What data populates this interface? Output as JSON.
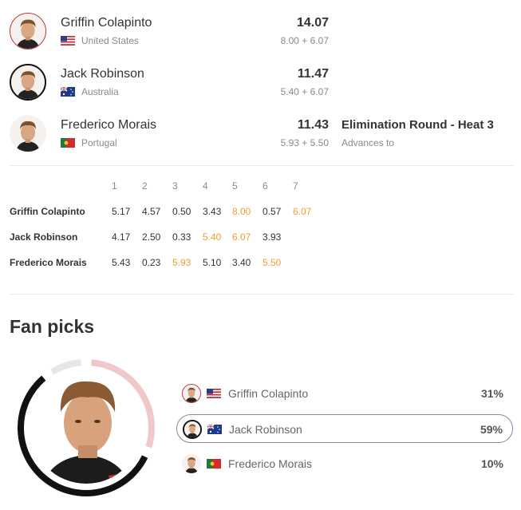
{
  "heat": {
    "surfers": [
      {
        "name": "Griffin Colapinto",
        "country": "United States",
        "flag": "us-flag",
        "total": "14.07",
        "breakdown": "8.00 + 6.07",
        "avatar_ring": "#c0303a"
      },
      {
        "name": "Jack Robinson",
        "country": "Australia",
        "flag": "au-flag",
        "total": "11.47",
        "breakdown": "5.40 + 6.07",
        "avatar_ring": "#111111"
      },
      {
        "name": "Frederico Morais",
        "country": "Portugal",
        "flag": "pt-flag",
        "total": "11.43",
        "breakdown": "5.93 + 5.50",
        "avatar_ring": "#ffffff"
      }
    ],
    "next_round": {
      "title": "Elimination Round - Heat 3",
      "subtitle": "Advances to"
    }
  },
  "waves": {
    "headers": [
      "1",
      "2",
      "3",
      "4",
      "5",
      "6",
      "7"
    ],
    "rows": [
      {
        "name": "Griffin Colapinto",
        "scores": [
          "5.17",
          "4.57",
          "0.50",
          "3.43",
          "8.00",
          "0.57",
          "6.07"
        ],
        "counting": [
          4,
          6
        ]
      },
      {
        "name": "Jack Robinson",
        "scores": [
          "4.17",
          "2.50",
          "0.33",
          "5.40",
          "6.07",
          "3.93"
        ],
        "counting": [
          3,
          4
        ]
      },
      {
        "name": "Frederico Morais",
        "scores": [
          "5.43",
          "0.23",
          "5.93",
          "5.10",
          "3.40",
          "5.50"
        ],
        "counting": [
          2,
          5
        ]
      }
    ]
  },
  "fan_picks": {
    "title": "Fan picks",
    "picks": [
      {
        "name": "Griffin Colapinto",
        "flag": "us-flag",
        "percent": "31%",
        "share": 0.31,
        "color": "#f0c8ca"
      },
      {
        "name": "Jack Robinson",
        "flag": "au-flag",
        "percent": "59%",
        "share": 0.59,
        "color": "#111111",
        "selected": true
      },
      {
        "name": "Frederico Morais",
        "flag": "pt-flag",
        "percent": "10%",
        "share": 0.1,
        "color": "#e6e6e6"
      }
    ]
  },
  "colors": {
    "counting_wave": "#f0a030",
    "accent_red": "#c0303a"
  }
}
